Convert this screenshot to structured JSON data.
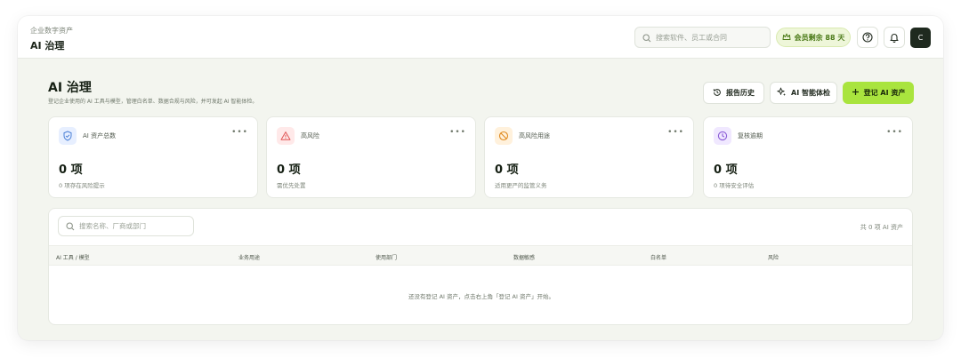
{
  "header": {
    "breadcrumb": "企业数字资产",
    "title": "AI 治理",
    "search_placeholder": "搜索软件、员工或合同",
    "member_badge": "会员剩余 88 天",
    "avatar_initial": "C"
  },
  "page": {
    "title": "AI 治理",
    "description": "登记企业使用的 AI 工具与模型，管理白名单、数据合规与风险，并可发起 AI 智能体检。",
    "actions": {
      "history": "报告历史",
      "checkup": "AI 智能体检",
      "register": "登记 AI 资产"
    }
  },
  "cards": [
    {
      "label": "AI 资产总数",
      "value": "0 项",
      "sub": "0 项存在风险提示",
      "icon": "shield-check-icon",
      "color": "#4a7fd6",
      "bg": "#e7efff"
    },
    {
      "label": "高风险",
      "value": "0 项",
      "sub": "需优先处置",
      "icon": "warning-icon",
      "color": "#e05656",
      "bg": "#ffe9e9"
    },
    {
      "label": "高风险用途",
      "value": "0 项",
      "sub": "适用更严的监管义务",
      "icon": "block-icon",
      "color": "#e08a1e",
      "bg": "#fff1dc"
    },
    {
      "label": "复核逾期",
      "value": "0 项",
      "sub": "0 项待安全评估",
      "icon": "clock-icon",
      "color": "#8a5cd6",
      "bg": "#f0e8ff"
    }
  ],
  "table": {
    "search_placeholder": "搜索名称、厂商或部门",
    "count": "共 0 项 AI 资产",
    "columns": [
      "AI 工具 / 模型",
      "业务用途",
      "使用部门",
      "数据敏感",
      "白名单",
      "风险"
    ],
    "empty_text": "还没有登记 AI 资产，点击右上角「登记 AI 资产」开始。"
  },
  "colors": {
    "accent": "#a9e43e",
    "member_text": "#4b7a18"
  }
}
